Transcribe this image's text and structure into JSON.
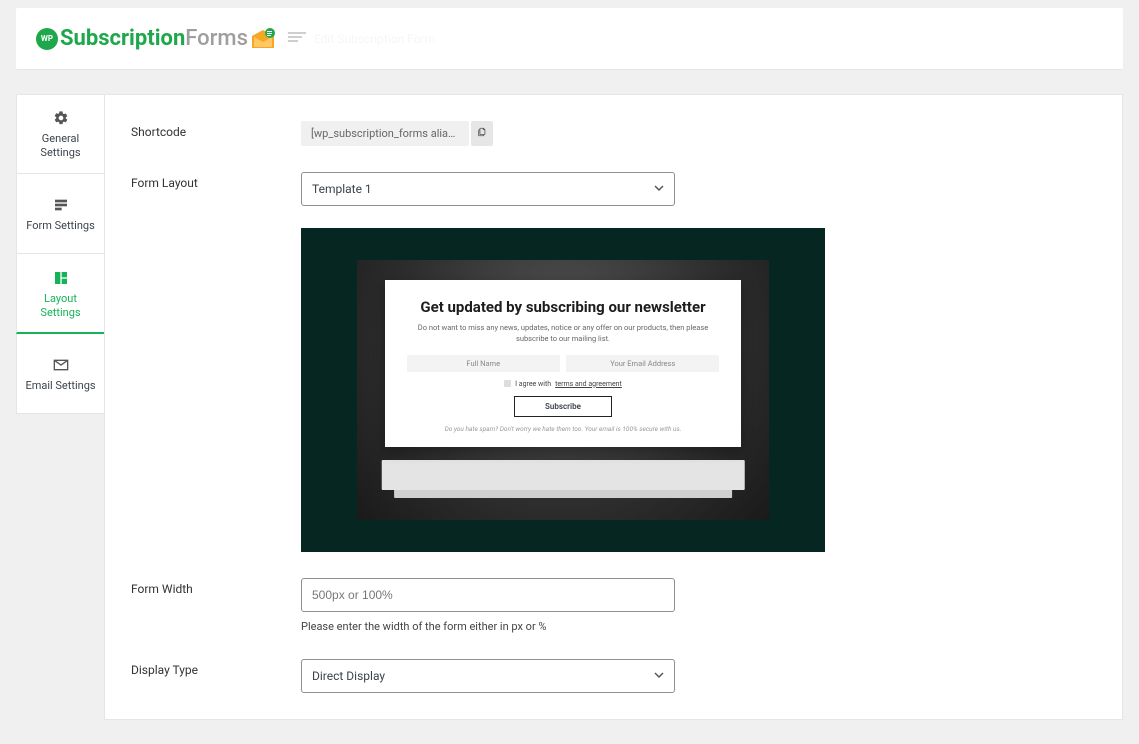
{
  "header": {
    "logo_wp": "WP",
    "logo_subscription": "Subscription",
    "logo_forms": "Forms",
    "tagline": "Edit Subscription Form"
  },
  "tabs": {
    "general": "General Settings",
    "form": "Form Settings",
    "layout": "Layout Settings",
    "email": "Email Settings"
  },
  "labels": {
    "shortcode": "Shortcode",
    "form_layout": "Form Layout",
    "form_width": "Form Width",
    "display_type": "Display Type"
  },
  "values": {
    "shortcode": "[wp_subscription_forms alias=\"sub...",
    "template_selected": "Template 1",
    "form_width_placeholder": "500px or 100%",
    "form_width_help": "Please enter the width of the form either in px or %",
    "display_type_selected": "Direct Display"
  },
  "preview": {
    "title": "Get updated by subscribing our newsletter",
    "desc": "Do not want to miss any news, updates, notice or any offer on our products, then please subscribe to our mailing list.",
    "full_name": "Full Name",
    "email": "Your Email Address",
    "agree_pre": "I agree with",
    "agree_link": "terms and agreement",
    "button": "Subscribe",
    "footer": "Do you hate spam? Don't worry we hate them too. Your email is 100% secure with us."
  }
}
